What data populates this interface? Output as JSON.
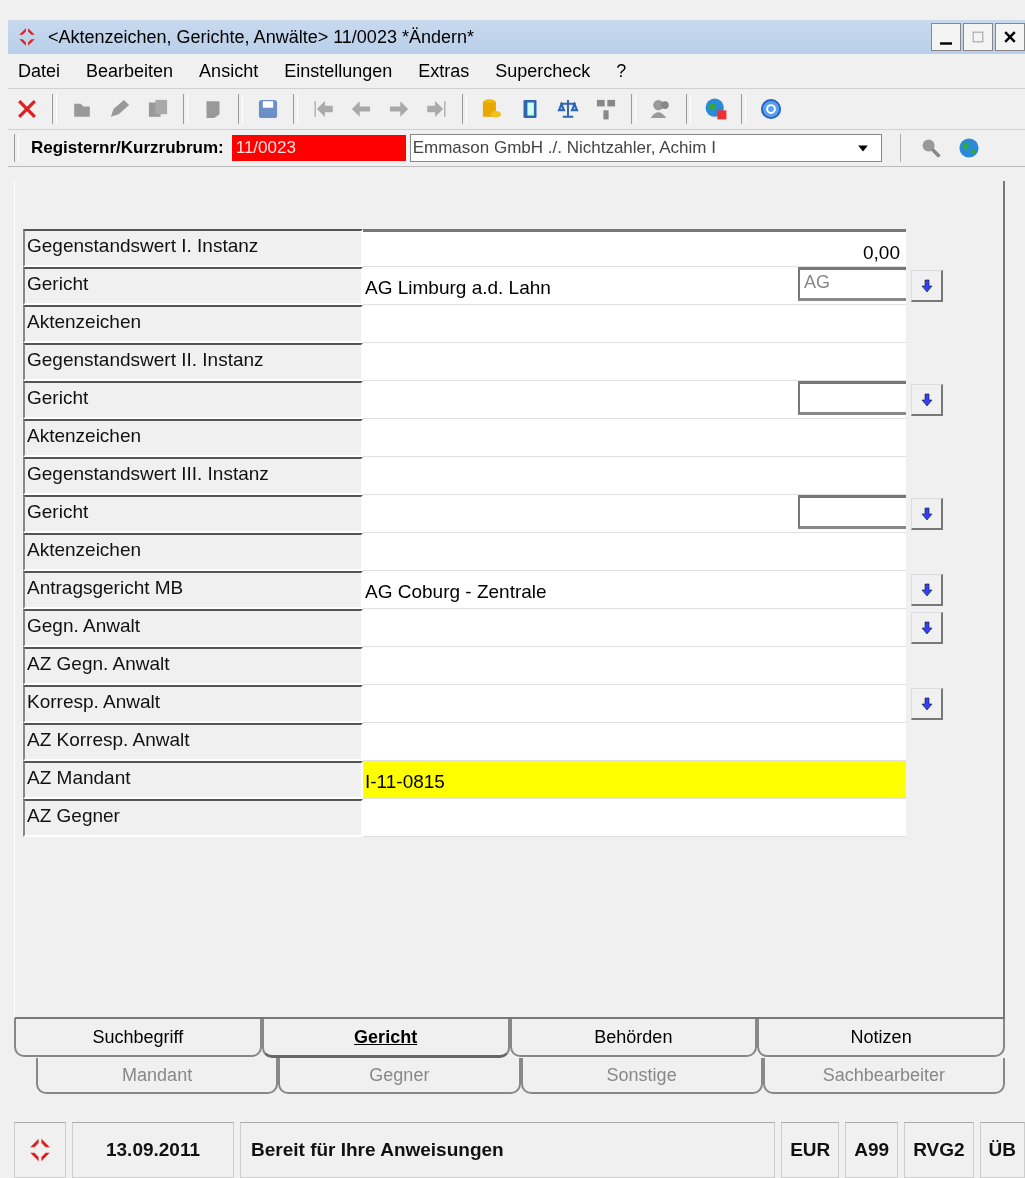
{
  "window": {
    "title": "<Aktenzeichen, Gerichte, Anwälte> 11/0023 *Ändern*"
  },
  "menu": [
    "Datei",
    "Bearbeiten",
    "Ansicht",
    "Einstellungen",
    "Extras",
    "Supercheck",
    "?"
  ],
  "register": {
    "label": "Registernr/Kurzrubrum:",
    "number": "11/0023",
    "rubrum": "Emmason GmbH ./. Nichtzahler, Achim I"
  },
  "rows": [
    {
      "label": "Gegenstandswert I. Instanz",
      "value": "0,00",
      "numeric": true,
      "code_field": false,
      "lookup": false,
      "highlight": false
    },
    {
      "label": "Gericht",
      "value": "AG Limburg a.d. Lahn",
      "numeric": false,
      "code_field": true,
      "code": "AG",
      "lookup": true,
      "highlight": false
    },
    {
      "label": "Aktenzeichen",
      "numeric": false,
      "code_field": false,
      "lookup": false,
      "highlight": false
    },
    {
      "label": "Gegenstandswert II. Instanz",
      "numeric": false,
      "code_field": false,
      "lookup": false,
      "highlight": false
    },
    {
      "label": "Gericht",
      "numeric": false,
      "code_field": true,
      "lookup": true,
      "highlight": false
    },
    {
      "label": "Aktenzeichen",
      "numeric": false,
      "code_field": false,
      "lookup": false,
      "highlight": false
    },
    {
      "label": "Gegenstandswert III. Instanz",
      "numeric": false,
      "code_field": false,
      "lookup": false,
      "highlight": false
    },
    {
      "label": "Gericht",
      "numeric": false,
      "code_field": true,
      "lookup": true,
      "highlight": false
    },
    {
      "label": "Aktenzeichen",
      "numeric": false,
      "code_field": false,
      "lookup": false,
      "highlight": false
    },
    {
      "label": "Antragsgericht MB",
      "value": "AG Coburg - Zentrale",
      "numeric": false,
      "code_field": false,
      "lookup": true,
      "highlight": false
    },
    {
      "label": "Gegn. Anwalt",
      "numeric": false,
      "code_field": false,
      "lookup": true,
      "highlight": false
    },
    {
      "label": "AZ Gegn. Anwalt",
      "numeric": false,
      "code_field": false,
      "lookup": false,
      "highlight": false
    },
    {
      "label": "Korresp. Anwalt",
      "numeric": false,
      "code_field": false,
      "lookup": true,
      "highlight": false
    },
    {
      "label": "AZ Korresp. Anwalt",
      "numeric": false,
      "code_field": false,
      "lookup": false,
      "highlight": false
    },
    {
      "label": "AZ Mandant",
      "value": "I-11-0815",
      "numeric": false,
      "code_field": false,
      "lookup": false,
      "highlight": true
    },
    {
      "label": "AZ Gegner",
      "numeric": false,
      "code_field": false,
      "lookup": false,
      "highlight": false
    }
  ],
  "tabs_front": [
    {
      "label": "Suchbegriff",
      "selected": false
    },
    {
      "label": "Gericht",
      "selected": true
    },
    {
      "label": "Behörden",
      "selected": false
    },
    {
      "label": "Notizen",
      "selected": false
    }
  ],
  "tabs_back": [
    {
      "label": "Mandant",
      "disabled": true
    },
    {
      "label": "Gegner",
      "disabled": true
    },
    {
      "label": "Sonstige",
      "disabled": true
    },
    {
      "label": "Sachbearbeiter",
      "disabled": true
    }
  ],
  "status_bar": {
    "date": "13.09.2011",
    "message": "Bereit für Ihre Anweisungen",
    "indicators": [
      "EUR",
      "A99",
      "RVG2",
      "ÜB"
    ]
  }
}
